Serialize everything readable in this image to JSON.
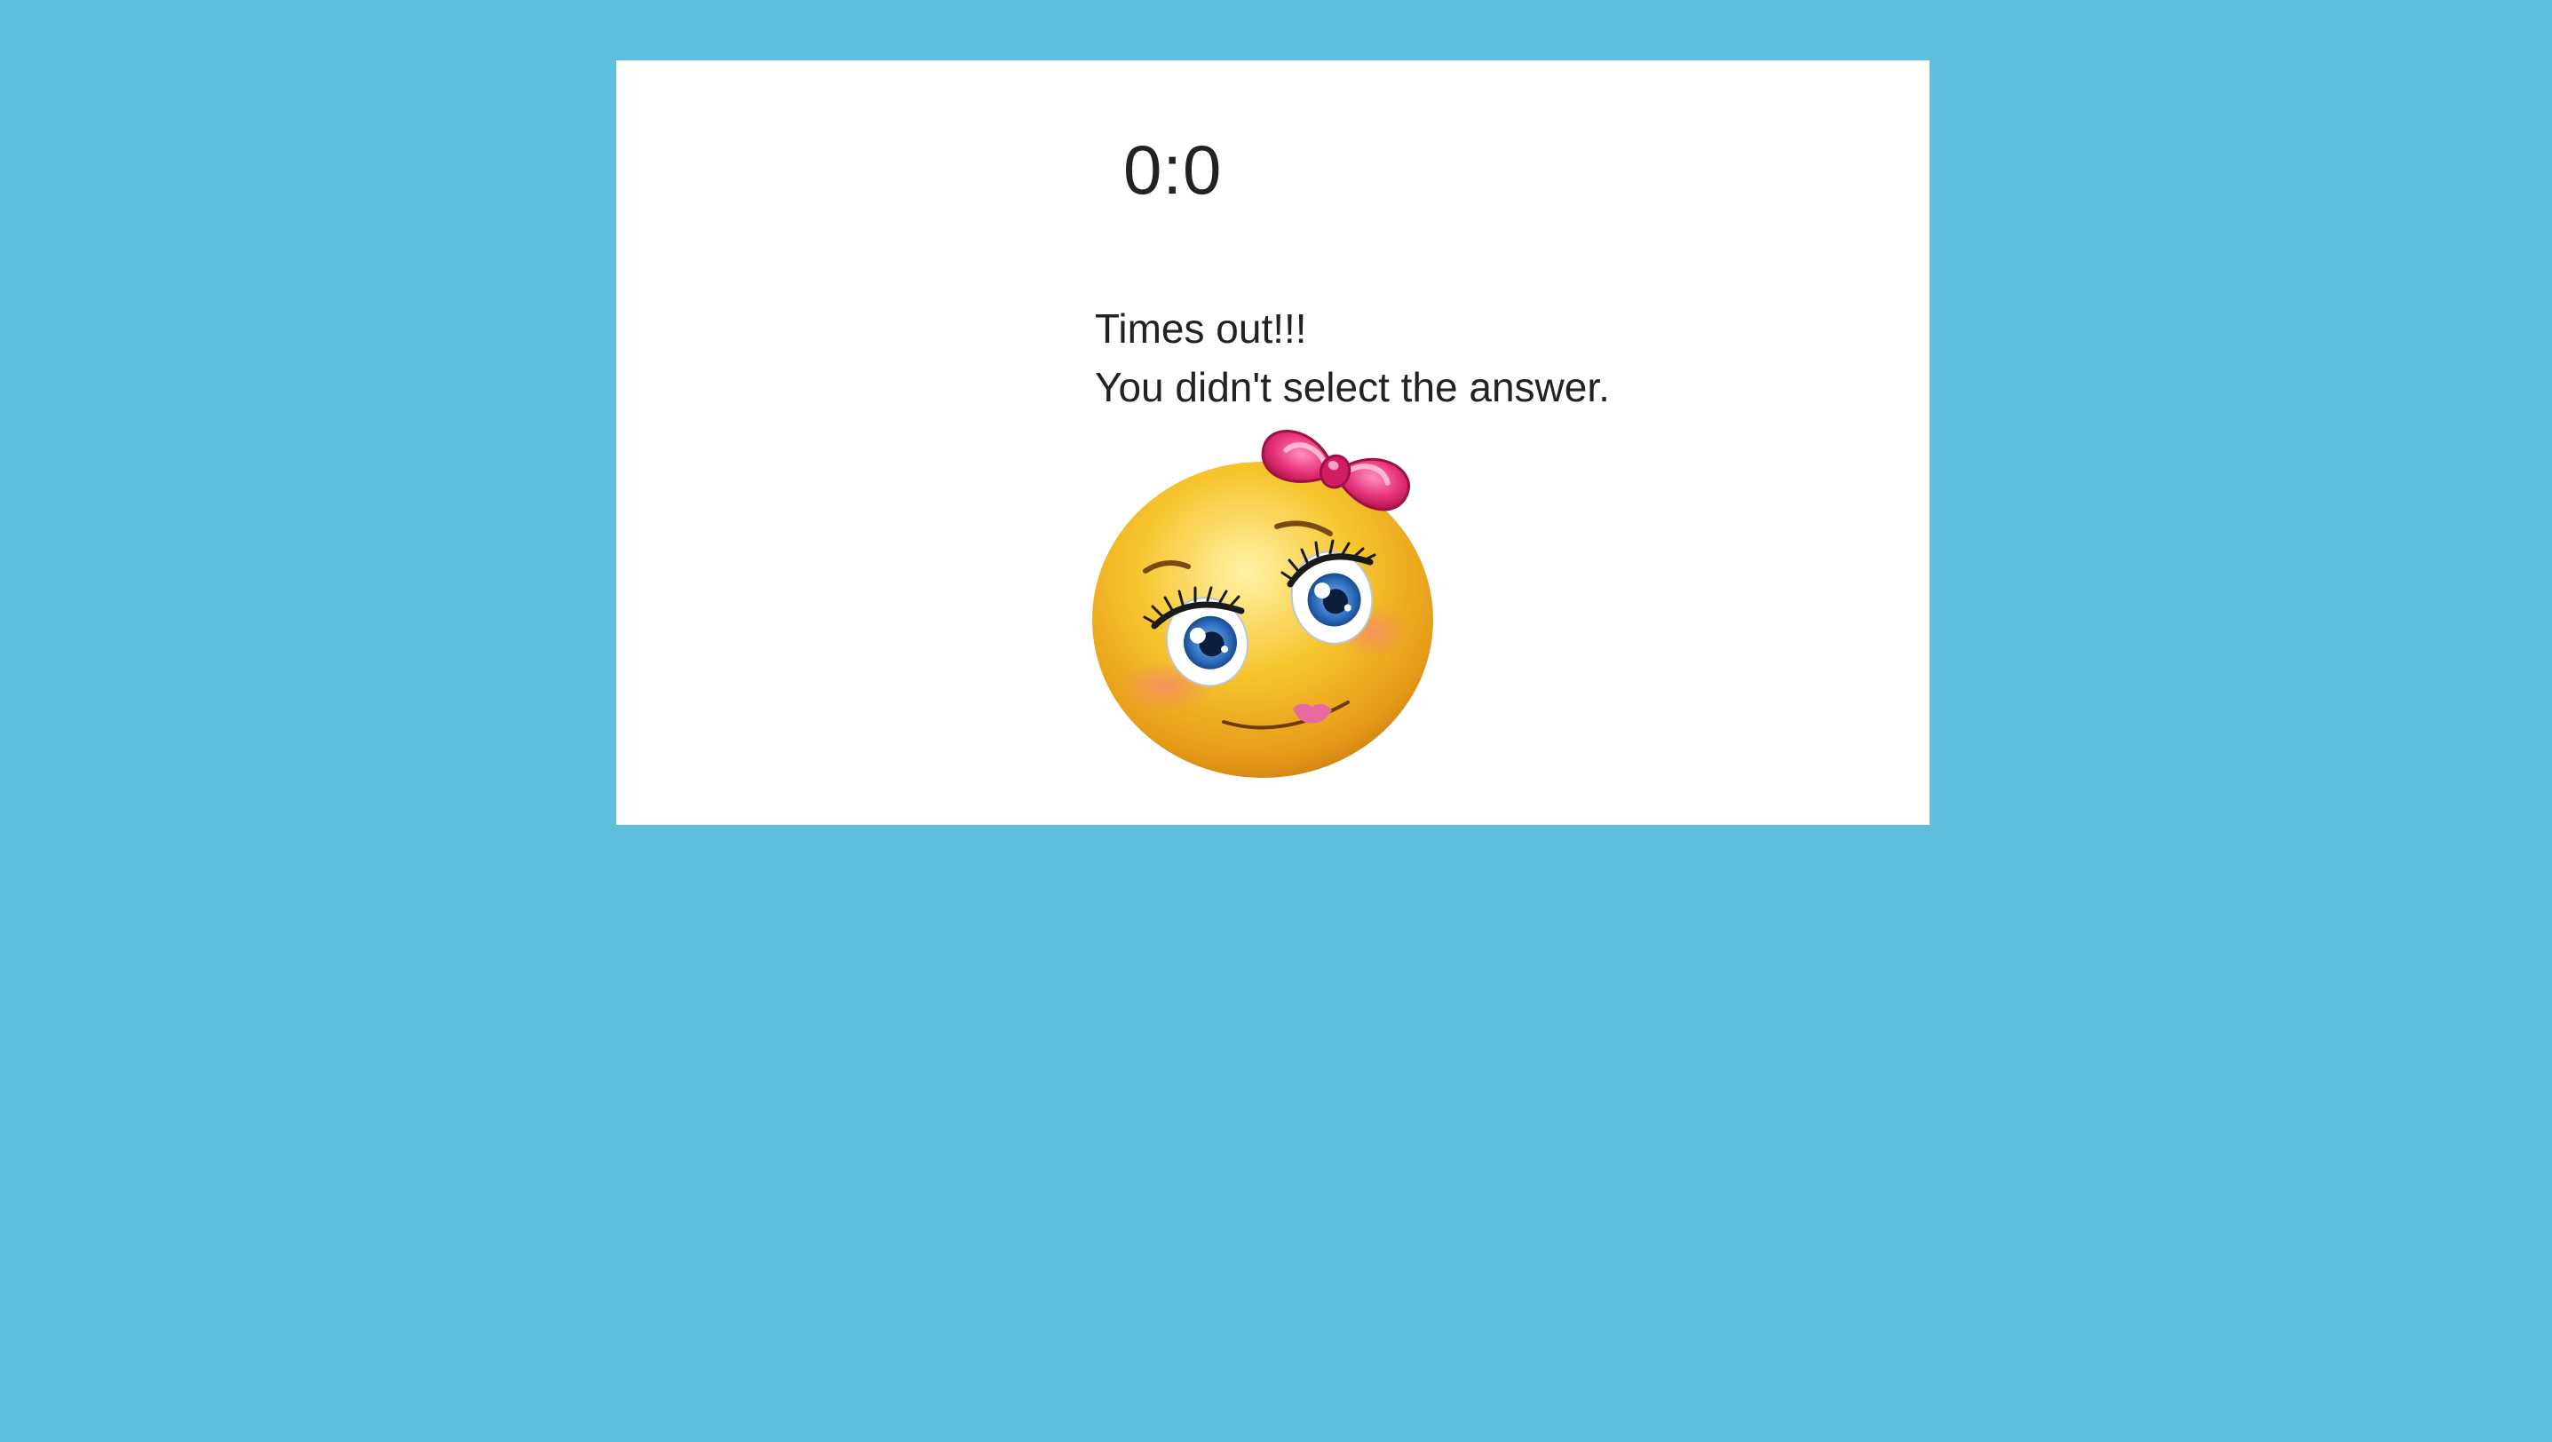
{
  "timer": {
    "display": "0:0"
  },
  "result": {
    "line1": "Times out!!!",
    "line2": "You didn't select the answer."
  },
  "image": {
    "icon": "smiley-girl-with-bow-icon"
  },
  "colors": {
    "background": "#5fbedd",
    "card": "#ffffff",
    "text": "#222222",
    "emoji_face": "#f4b623",
    "bow": "#e8357a",
    "eyes": "#2a68b8"
  }
}
